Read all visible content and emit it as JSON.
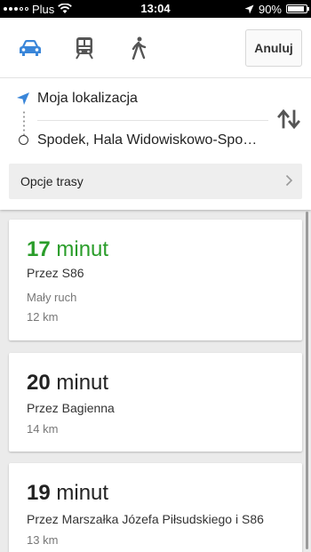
{
  "status_bar": {
    "carrier": "Plus",
    "time": "13:04",
    "battery": "90%",
    "battery_level": 0.9
  },
  "header": {
    "modes": [
      {
        "name": "car-icon",
        "active": true
      },
      {
        "name": "train-icon",
        "active": false
      },
      {
        "name": "walk-icon",
        "active": false
      }
    ],
    "cancel_label": "Anuluj"
  },
  "locations": {
    "from": "Moja lokalizacja",
    "to": "Spodek, Hala Widowiskowo-Spo…"
  },
  "route_options_label": "Opcje trasy",
  "routes": [
    {
      "minutes": "17",
      "unit": "minut",
      "via": "Przez S86",
      "traffic": "Mały ruch",
      "distance": "12 km",
      "highlight": true
    },
    {
      "minutes": "20",
      "unit": "minut",
      "via": "Przez Bagienna",
      "distance": "14 km",
      "highlight": false
    },
    {
      "minutes": "19",
      "unit": "minut",
      "via": "Przez Marszałka Józefa Piłsudskiego i S86",
      "distance": "13 km",
      "highlight": false
    }
  ],
  "colors": {
    "accent": "#3a86d9",
    "fastest": "#2a9d2a"
  }
}
